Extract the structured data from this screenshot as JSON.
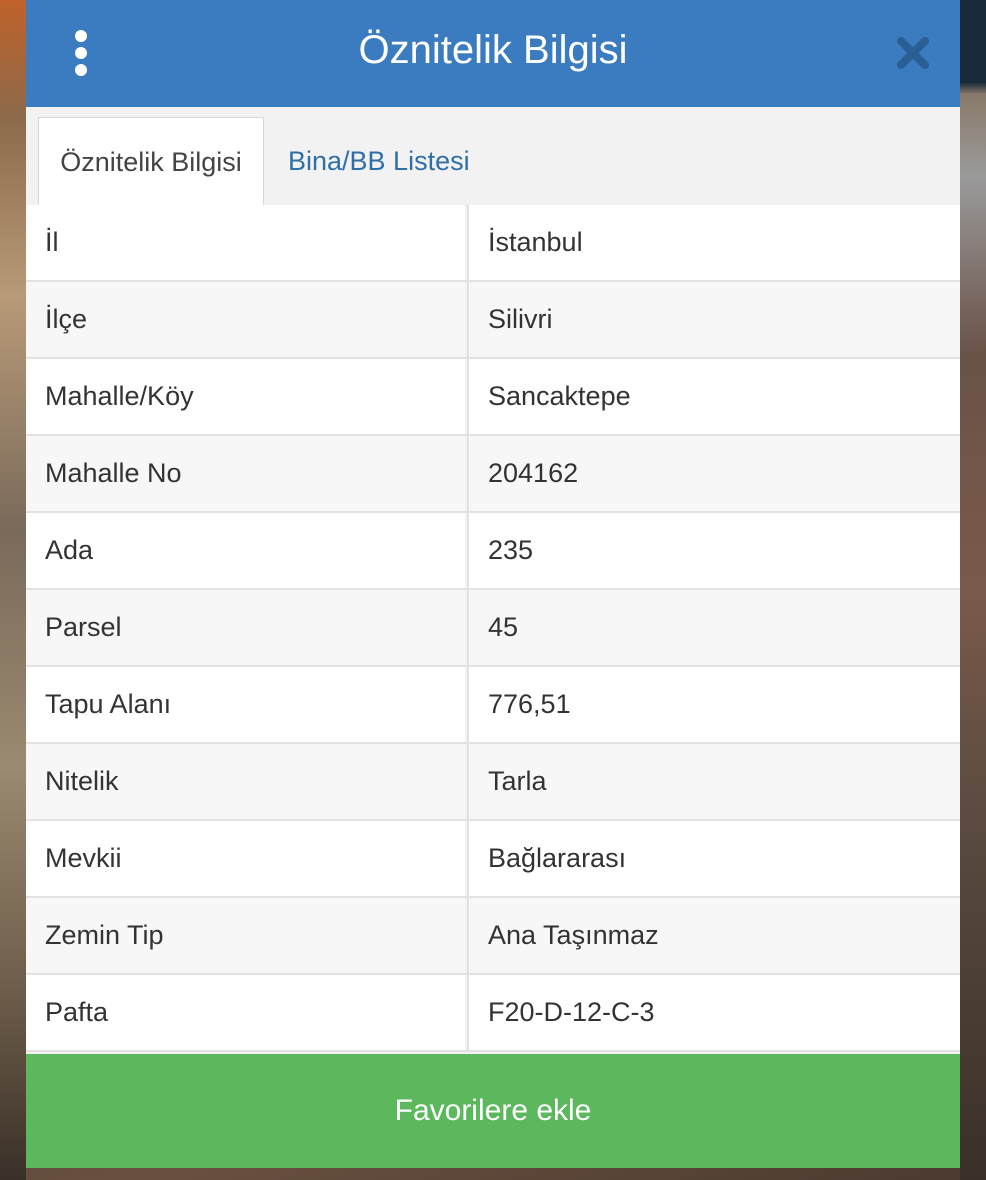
{
  "header": {
    "title": "Öznitelik Bilgisi",
    "menu_icon": "vertical-dots-icon",
    "close_icon": "close-icon",
    "color": "#3b7bbf"
  },
  "tabs": [
    {
      "label": "Öznitelik Bilgisi",
      "active": true
    },
    {
      "label": "Bina/BB Listesi",
      "active": false
    }
  ],
  "table": {
    "rows": [
      {
        "key": "İl",
        "value": "İstanbul"
      },
      {
        "key": "İlçe",
        "value": "Silivri"
      },
      {
        "key": "Mahalle/Köy",
        "value": "Sancaktepe"
      },
      {
        "key": "Mahalle No",
        "value": "204162"
      },
      {
        "key": "Ada",
        "value": "235"
      },
      {
        "key": "Parsel",
        "value": "45"
      },
      {
        "key": "Tapu Alanı",
        "value": "776,51"
      },
      {
        "key": "Nitelik",
        "value": "Tarla"
      },
      {
        "key": "Mevkii",
        "value": "Bağlararası"
      },
      {
        "key": "Zemin Tip",
        "value": "Ana Taşınmaz"
      },
      {
        "key": "Pafta",
        "value": "F20-D-12-C-3"
      }
    ]
  },
  "footer": {
    "favorite_label": "Favorilere ekle",
    "color": "#5cb85c"
  }
}
